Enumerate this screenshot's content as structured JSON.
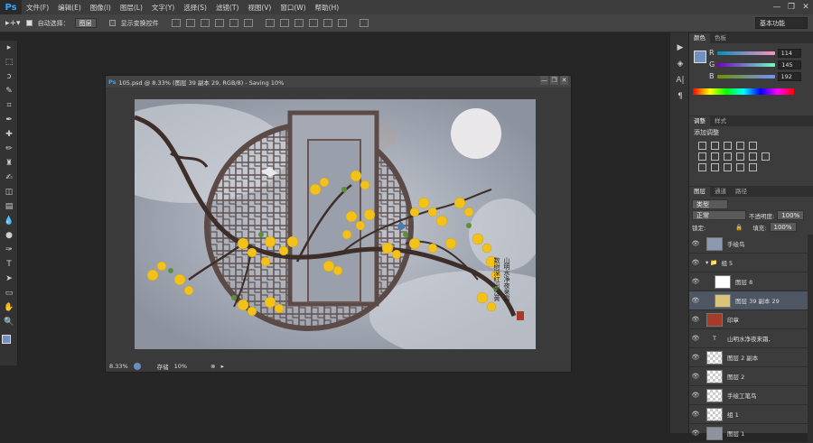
{
  "app": {
    "logo": "Ps"
  },
  "menu": [
    "文件(F)",
    "编辑(E)",
    "图像(I)",
    "图层(L)",
    "文字(Y)",
    "选择(S)",
    "滤镜(T)",
    "视图(V)",
    "窗口(W)",
    "帮助(H)"
  ],
  "window_controls": [
    "—",
    "❐",
    "✕"
  ],
  "options": {
    "auto_select_label": "自动选择：",
    "auto_select_value": "图层",
    "show_transform_label": "显示变换控件",
    "workspace": "基本功能"
  },
  "tools": [
    "move-icon",
    "marquee-icon",
    "lasso-icon",
    "quick-select-icon",
    "crop-icon",
    "eyedropper-icon",
    "healing-icon",
    "brush-icon",
    "stamp-icon",
    "history-brush-icon",
    "eraser-icon",
    "gradient-icon",
    "blur-icon",
    "dodge-icon",
    "pen-icon",
    "type-icon",
    "path-select-icon",
    "shape-icon",
    "hand-icon",
    "zoom-icon"
  ],
  "tool_glyphs": [
    "▸",
    "⬚",
    "ↄ",
    "✎",
    "⌗",
    "✒",
    "✚",
    "✏",
    "♜",
    "✍",
    "◫",
    "▤",
    "💧",
    "●",
    "✑",
    "T",
    "➤",
    "▭",
    "✋",
    "🔍"
  ],
  "document": {
    "title": "105.psd @ 8.33% (图层 39 副本 29, RGB/8) - Saving 10%",
    "zoom": "8.33%",
    "status_label": "存储",
    "status_value": "10%"
  },
  "artwork": {
    "poem_line1": "山明水净夜来霜",
    "poem_line2": "数树深红出浅黄",
    "seal": "印"
  },
  "dock_icons": [
    "▶",
    "◈",
    "A|",
    "¶"
  ],
  "color_panel": {
    "tabs": [
      "颜色",
      "色板"
    ],
    "channels": [
      {
        "label": "R",
        "value": "114"
      },
      {
        "label": "G",
        "value": "145"
      },
      {
        "label": "B",
        "value": "192"
      }
    ],
    "fg_color": "#7291c0"
  },
  "adjust_panel": {
    "tabs": [
      "调整",
      "样式"
    ],
    "title": "添加调整"
  },
  "layers_panel": {
    "tabs": [
      "图层",
      "通道",
      "路径"
    ],
    "filter": "类型",
    "blend": "正常",
    "opacity_label": "不透明度:",
    "opacity": "100%",
    "lock_label": "锁定:",
    "fill_label": "填充:",
    "fill": "100%",
    "layers": [
      {
        "name": "手绘鸟",
        "kind": "image",
        "selected": false
      },
      {
        "name": "组 5",
        "kind": "group",
        "selected": false
      },
      {
        "name": "图层 8",
        "kind": "white",
        "selected": false
      },
      {
        "name": "图层 39 副本 29",
        "kind": "flower",
        "selected": true
      },
      {
        "name": "印章",
        "kind": "seal",
        "selected": false
      },
      {
        "name": "山明水净夜来霜,",
        "kind": "text",
        "selected": false
      },
      {
        "name": "图层 2 副本",
        "kind": "checker",
        "selected": false
      },
      {
        "name": "图层 2",
        "kind": "checker",
        "selected": false
      },
      {
        "name": "手绘工笔鸟",
        "kind": "checker",
        "selected": false
      },
      {
        "name": "组 1",
        "kind": "checker",
        "selected": false
      },
      {
        "name": "图层 1",
        "kind": "gray",
        "selected": false
      }
    ]
  }
}
